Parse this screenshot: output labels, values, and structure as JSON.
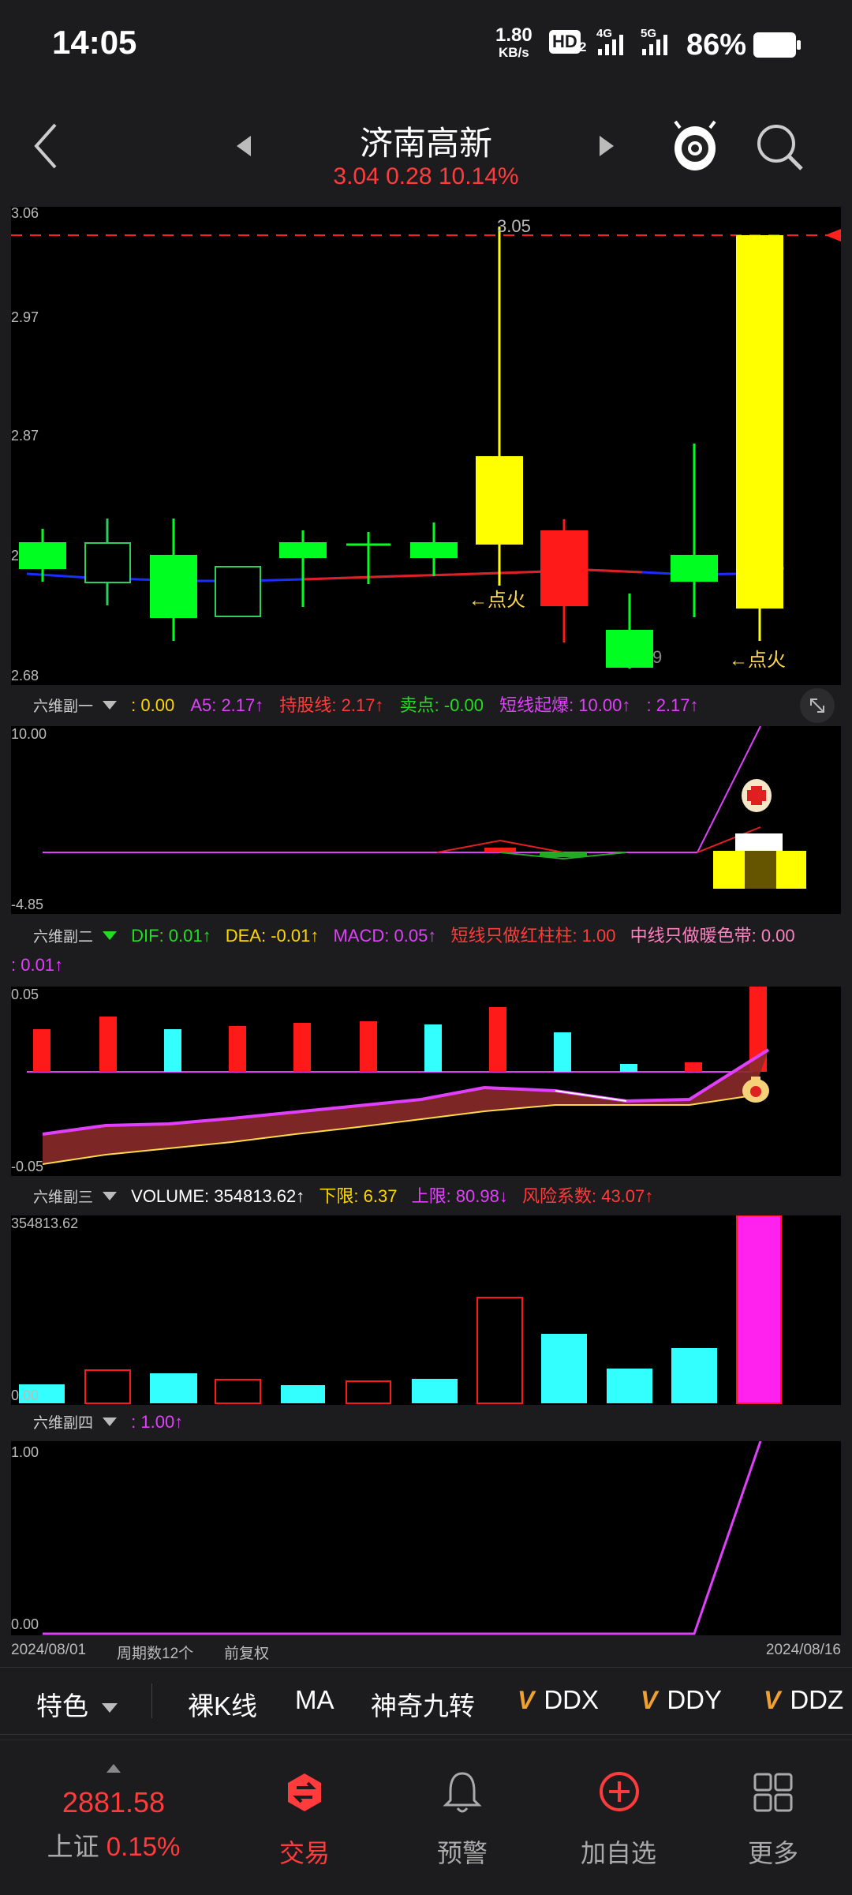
{
  "status_bar": {
    "time": "14:05",
    "net_speed_value": "1.80",
    "net_speed_unit": "KB/s",
    "hd": "HD",
    "hd_sub": "2",
    "sig1": "4G",
    "sig2": "5G",
    "battery": "86%"
  },
  "header": {
    "back_icon": "back-arrow-icon",
    "title": "济南高新",
    "quote": "3.04  0.28  10.14%",
    "prev_icon": "triangle-left-icon",
    "next_icon": "triangle-right-icon",
    "mascot_icon": "mascot-icon",
    "search_icon": "search-icon"
  },
  "kline": {
    "y_labels": [
      "3.06",
      "2.97",
      "2.87",
      "2",
      "2.68"
    ],
    "high_label": "3.05",
    "low_label": "9",
    "signal_labels": [
      "←点火",
      "←点火"
    ],
    "colors": {
      "up": "#ffff00",
      "down_green": "#00ff20",
      "red": "#ff1a1a",
      "hollow": "#2fcf5f"
    }
  },
  "ind1": {
    "name": "六维副一",
    "items": [
      {
        "text": ": 0.00",
        "color": "#ffd700"
      },
      {
        "text": "A5: 2.17↑",
        "color": "#e040fb"
      },
      {
        "text": "持股线: 2.17↑",
        "color": "#ff3b3b"
      },
      {
        "text": "卖点: -0.00",
        "color": "#22dd22"
      },
      {
        "text": "短线起爆: 10.00↑",
        "color": "#e040fb"
      },
      {
        "text": ": 2.17↑",
        "color": "#e040fb"
      }
    ],
    "y_top": "10.00",
    "y_bottom": "-4.85"
  },
  "ind2": {
    "name": "六维副二",
    "items": [
      {
        "text": "DIF: 0.01↑",
        "color": "#22dd22"
      },
      {
        "text": "DEA: -0.01↑",
        "color": "#ffd700"
      },
      {
        "text": "MACD: 0.05↑",
        "color": "#e040fb"
      },
      {
        "text": "短线只做红柱柱: 1.00",
        "color": "#ff3b3b"
      },
      {
        "text": "中线只做暖色带: 0.00",
        "color": "#ff80c0"
      }
    ],
    "line2": ": 0.01↑",
    "y_top": "0.05",
    "y_bottom": "-0.05"
  },
  "ind3": {
    "name": "六维副三",
    "items": [
      {
        "text": "VOLUME: 354813.62↑",
        "color": "#ffffff"
      },
      {
        "text": "下限: 6.37",
        "color": "#ffd700"
      },
      {
        "text": "上限: 80.98↓",
        "color": "#e040fb"
      },
      {
        "text": "风险系数: 43.07↑",
        "color": "#ff3b3b"
      }
    ],
    "y_top": "354813.62",
    "y_bottom": "0.00"
  },
  "ind4": {
    "name": "六维副四",
    "items": [
      {
        "text": ": 1.00↑",
        "color": "#e040fb"
      }
    ],
    "y_top": "1.00",
    "y_bottom": "0.00"
  },
  "footer": {
    "date_start": "2024/08/01",
    "period": "周期数12个",
    "adjust": "前复权",
    "date_end": "2024/08/16"
  },
  "toolbar": {
    "feature": "特色",
    "tabs": [
      "裸K线",
      "MA",
      "神奇九转"
    ],
    "v_tabs": [
      "DDX",
      "DDY",
      "DDZ"
    ]
  },
  "nav": {
    "index_value": "2881.58",
    "index_name": "上证",
    "index_change": "0.15%",
    "items": [
      "交易",
      "预警",
      "加自选",
      "更多"
    ]
  }
}
